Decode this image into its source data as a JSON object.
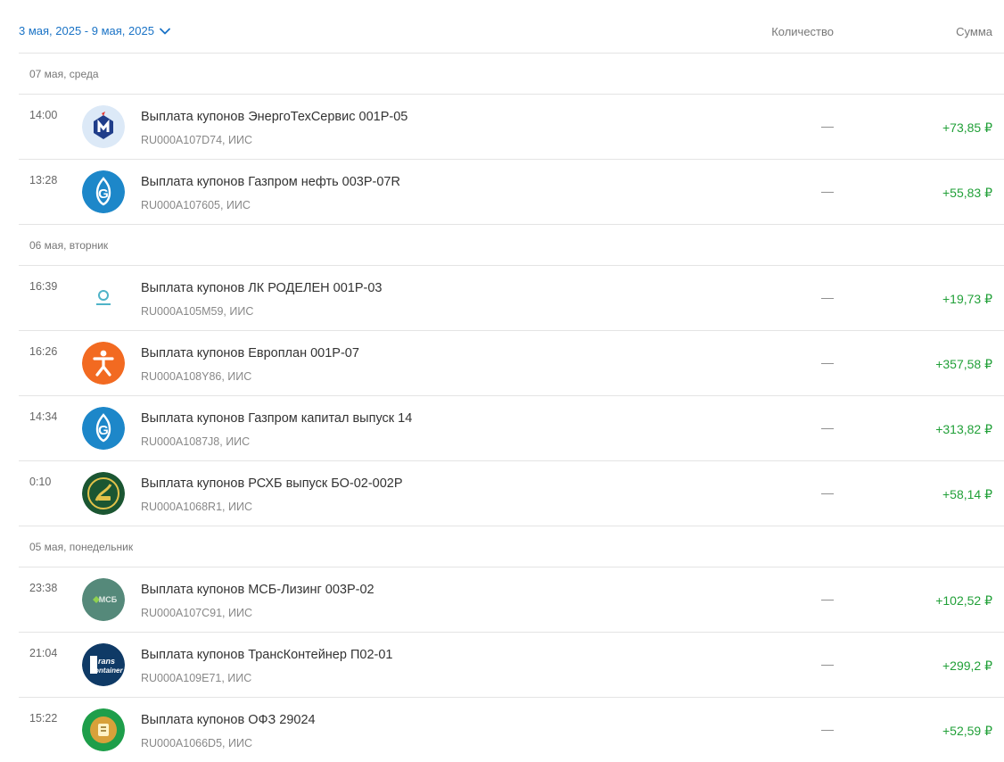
{
  "header": {
    "date_range": "3 мая, 2025 - 9 мая, 2025",
    "col_quantity": "Количество",
    "col_sum": "Сумма"
  },
  "days": [
    {
      "label": "07 мая, среда",
      "items": [
        {
          "time": "14:00",
          "title": "Выплата купонов ЭнергоТехСервис 001Р-05",
          "sub": "RU000A107D74, ИИС",
          "qty": "—",
          "amount": "+73,85 ₽",
          "icon": "energotechservice-logo-icon"
        },
        {
          "time": "13:28",
          "title": "Выплата купонов Газпром нефть 003Р-07R",
          "sub": "RU000A107605, ИИС",
          "qty": "—",
          "amount": "+55,83 ₽",
          "icon": "gazprom-logo-icon"
        }
      ]
    },
    {
      "label": "06 мая, вторник",
      "items": [
        {
          "time": "16:39",
          "title": "Выплата купонов ЛК РОДЕЛЕН 001Р-03",
          "sub": "RU000A105M59, ИИС",
          "qty": "—",
          "amount": "+19,73 ₽",
          "icon": "rodelen-logo-icon"
        },
        {
          "time": "16:26",
          "title": "Выплата купонов Европлан 001Р-07",
          "sub": "RU000A108Y86, ИИС",
          "qty": "—",
          "amount": "+357,58 ₽",
          "icon": "europlan-logo-icon"
        },
        {
          "time": "14:34",
          "title": "Выплата купонов Газпром капитал выпуск 14",
          "sub": "RU000A1087J8, ИИС",
          "qty": "—",
          "amount": "+313,82 ₽",
          "icon": "gazprom-logo-icon"
        },
        {
          "time": "0:10",
          "title": "Выплата купонов РСХБ выпуск БО-02-002Р",
          "sub": "RU000A1068R1, ИИС",
          "qty": "—",
          "amount": "+58,14 ₽",
          "icon": "rshb-logo-icon"
        }
      ]
    },
    {
      "label": "05 мая, понедельник",
      "items": [
        {
          "time": "23:38",
          "title": "Выплата купонов МСБ-Лизинг 003Р-02",
          "sub": "RU000A107C91, ИИС",
          "qty": "—",
          "amount": "+102,52 ₽",
          "icon": "msb-leasing-logo-icon"
        },
        {
          "time": "21:04",
          "title": "Выплата купонов ТрансКонтейнер П02-01",
          "sub": "RU000A109E71, ИИС",
          "qty": "—",
          "amount": "+299,2 ₽",
          "icon": "transcontainer-logo-icon"
        },
        {
          "time": "15:22",
          "title": "Выплата купонов ОФЗ 29024",
          "sub": "RU000A1066D5, ИИС",
          "qty": "—",
          "amount": "+52,59 ₽",
          "icon": "minfin-logo-icon"
        }
      ]
    }
  ],
  "colors": {
    "accent": "#1a73c6",
    "positive": "#21a038",
    "divider": "#e4e4e4"
  }
}
